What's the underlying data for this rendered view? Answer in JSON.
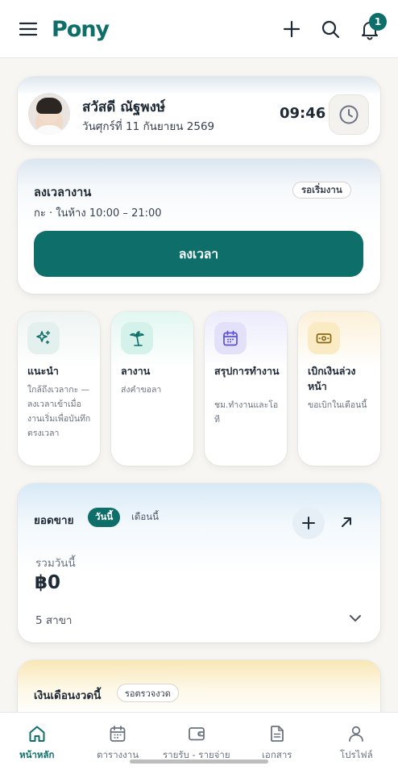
{
  "app": {
    "logo_text": "Pony",
    "brand_color": "#0e6f6a"
  },
  "header": {
    "menu_icon": "hamburger-menu-icon",
    "add_icon": "plus-icon",
    "search_icon": "search-icon",
    "notification_icon": "bell-icon",
    "notification_count": "1"
  },
  "greeting": {
    "name": "สวัสดี ณัฐพงษ์",
    "date": "วันศุกร์ที่ 11 กันยายน 2569",
    "time": "09:46",
    "clock_icon": "clock-icon"
  },
  "clock_in": {
    "title": "ลงเวลางาน",
    "shift": "กะ · ในห้าง 10:00 – 21:00",
    "status": "รอเริ่มงาน",
    "button_label": "ลงเวลา"
  },
  "quick_actions": [
    {
      "title": "แนะนำ",
      "description": "ใกล้ถึงเวลากะ — ลงเวลาเข้าเมื่องานเริ่มเพื่อบันทึกตรงเวลา",
      "icon": "sparkles-icon",
      "color": "#e6f2f0"
    },
    {
      "title": "ลางาน",
      "description": "ส่งคำขอลา",
      "icon": "palm-tree-icon",
      "color": "#dff5ef"
    },
    {
      "title": "สรุปการทำงาน",
      "description": "ชม.ทำงานและโอที",
      "icon": "calendar-icon",
      "color": "#e8e6fb"
    },
    {
      "title": "เบิกเงินล่วงหน้า",
      "description": "ขอเบิกในเดือนนี้",
      "icon": "cash-icon",
      "color": "#fbefcf"
    }
  ],
  "sales": {
    "title": "ยอดขาย",
    "tabs": [
      "วันนี้",
      "เดือนนี้"
    ],
    "active_tab": "วันนี้",
    "label": "รวมวันนี้",
    "amount": "฿0",
    "branches": "5 สาขา"
  },
  "salary": {
    "title": "เงินเดือนงวดนี้",
    "status": "รอตรวจงวด"
  },
  "bottom_nav": [
    {
      "label": "หน้าหลัก",
      "icon": "home-icon",
      "active": true
    },
    {
      "label": "ตารางงาน",
      "icon": "calendar-icon",
      "active": false
    },
    {
      "label": "รายรับ - รายจ่าย",
      "icon": "wallet-icon",
      "active": false
    },
    {
      "label": "เอกสาร",
      "icon": "document-icon",
      "active": false
    },
    {
      "label": "โปรไฟล์",
      "icon": "user-icon",
      "active": false
    }
  ]
}
